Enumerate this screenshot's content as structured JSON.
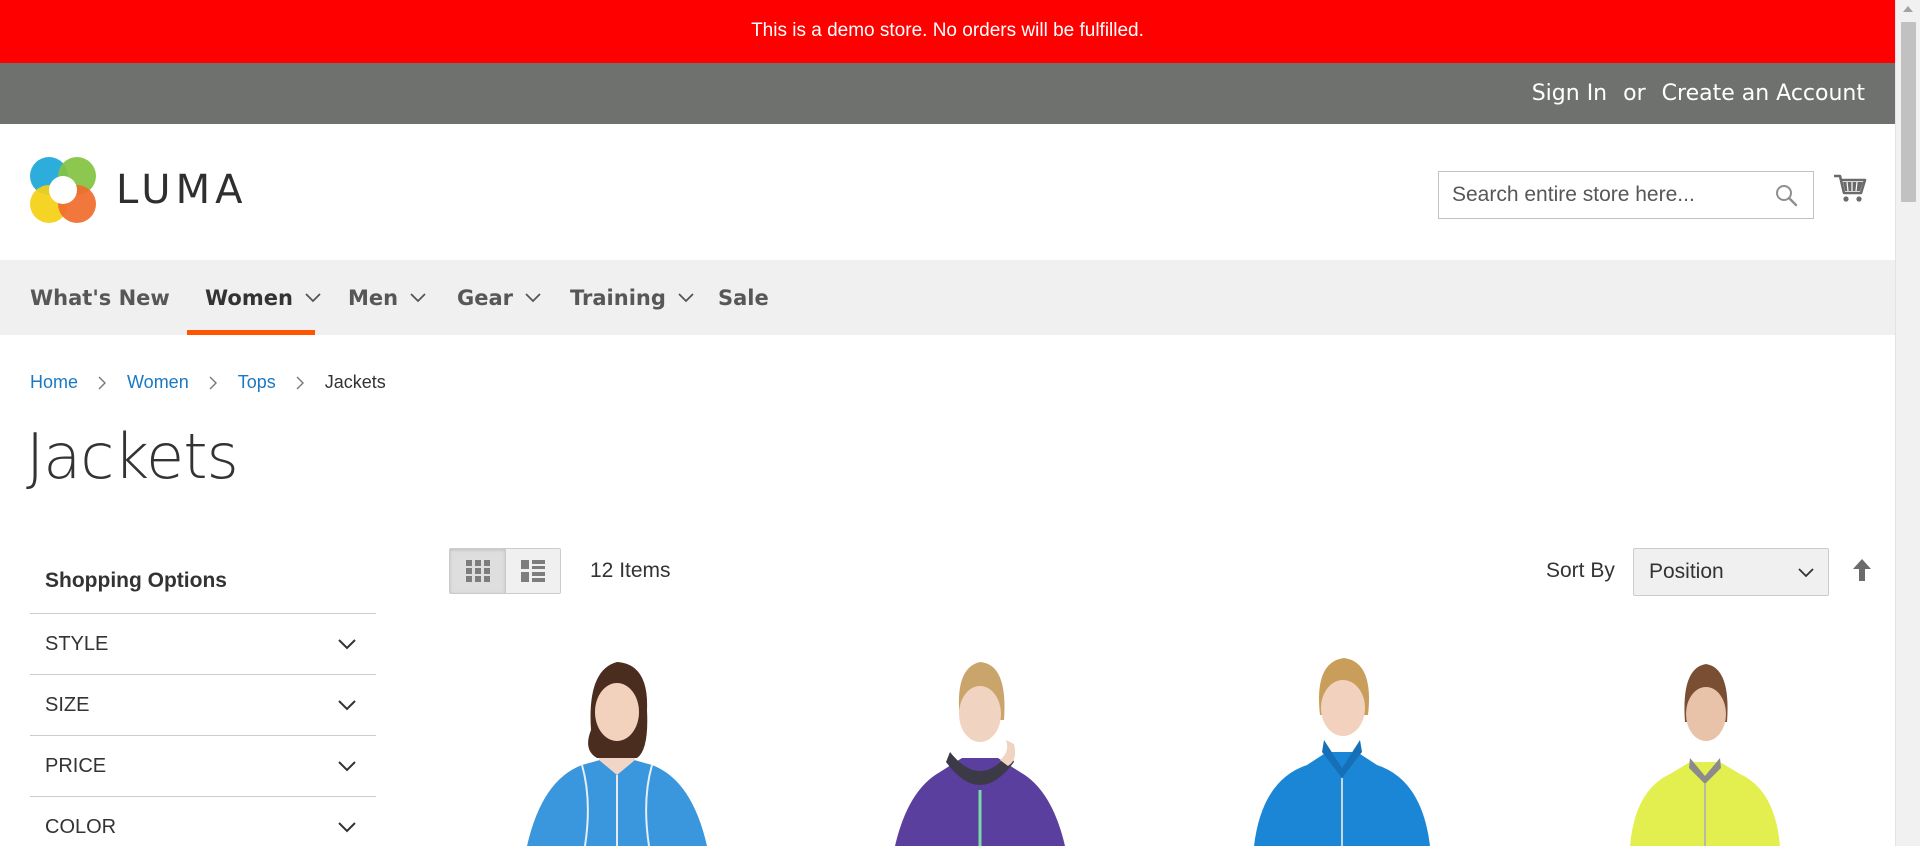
{
  "demo_notice": "This is a demo store. No orders will be fulfilled.",
  "top_links": {
    "sign_in": "Sign In",
    "or": "or",
    "create_account": "Create an Account"
  },
  "logo": {
    "text": "LUMA"
  },
  "search": {
    "placeholder": "Search entire store here..."
  },
  "nav": {
    "items": [
      {
        "label": "What's New",
        "has_dropdown": false
      },
      {
        "label": "Women",
        "has_dropdown": true,
        "active": true
      },
      {
        "label": "Men",
        "has_dropdown": true
      },
      {
        "label": "Gear",
        "has_dropdown": true
      },
      {
        "label": "Training",
        "has_dropdown": true
      },
      {
        "label": "Sale",
        "has_dropdown": false
      }
    ]
  },
  "breadcrumb": {
    "home": "Home",
    "women": "Women",
    "tops": "Tops",
    "current": "Jackets"
  },
  "page_title": "Jackets",
  "sidebar": {
    "title": "Shopping Options",
    "filters": [
      "STYLE",
      "SIZE",
      "PRICE",
      "COLOR"
    ]
  },
  "toolbar": {
    "amount": "12 Items",
    "sort_label": "Sort By",
    "sort_value": "Position"
  },
  "colors": {
    "demo_bar": "#ff0000",
    "top_bar": "#6e716e",
    "nav_bg": "#f0f0f0",
    "accent": "#ff5501",
    "link": "#1979c3"
  },
  "products": [
    {
      "jacket_color": "#3a96dd"
    },
    {
      "jacket_color": "#5b3f9e"
    },
    {
      "jacket_color": "#1c86d6"
    },
    {
      "jacket_color": "#e3ef4e"
    }
  ]
}
